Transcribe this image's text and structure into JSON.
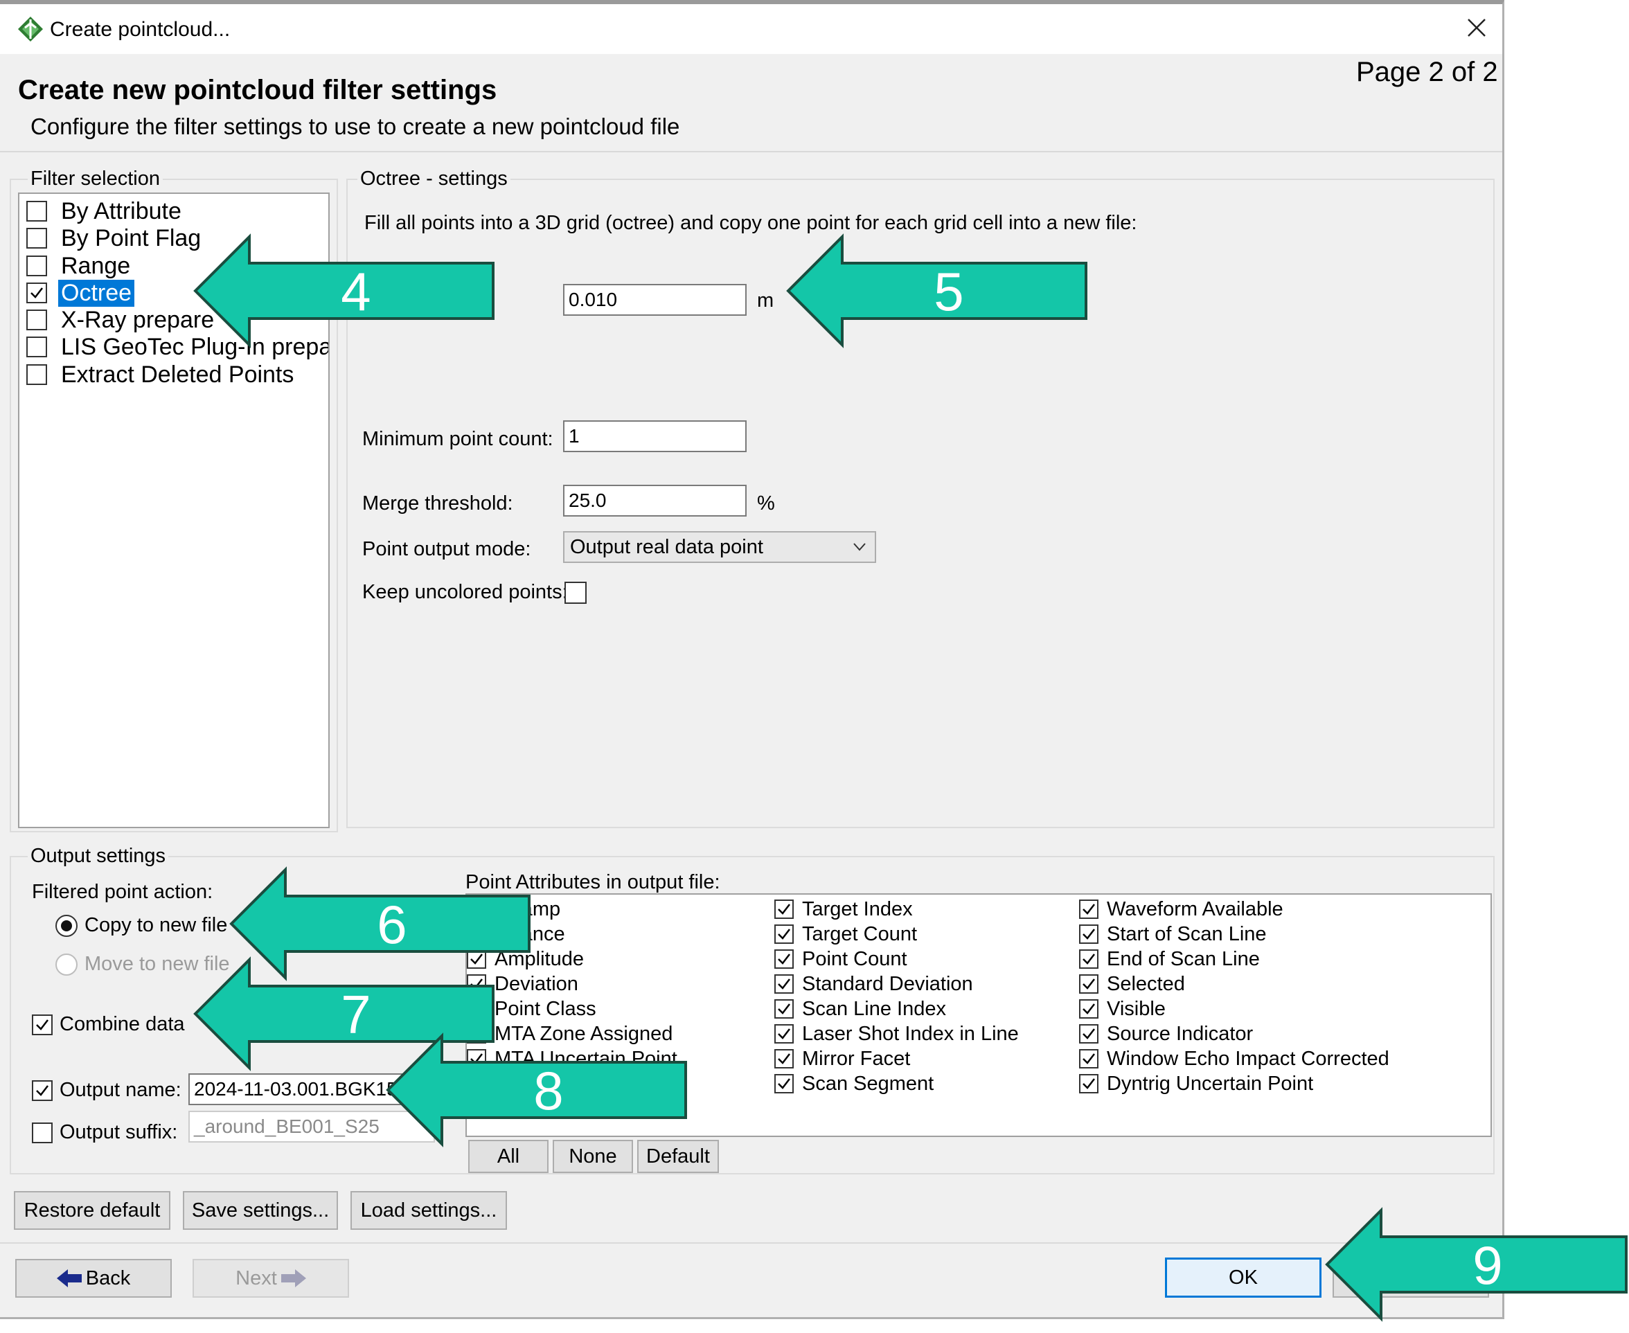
{
  "window": {
    "title": "Create pointcloud...",
    "page_indicator": "Page 2 of 2"
  },
  "header": {
    "title": "Create new pointcloud filter settings",
    "subtitle": "Configure the filter settings to use to create a new pointcloud file"
  },
  "filter_selection": {
    "label": "Filter selection",
    "items": [
      {
        "label": "By Attribute",
        "checked": false
      },
      {
        "label": "By Point Flag",
        "checked": false
      },
      {
        "label": "Range",
        "checked": false
      },
      {
        "label": "Octree",
        "checked": true
      },
      {
        "label": "X-Ray prepare",
        "checked": false
      },
      {
        "label": "LIS GeoTec Plug-In prepare",
        "checked": false
      },
      {
        "label": "Extract Deleted Points",
        "checked": false
      }
    ]
  },
  "octree": {
    "label": "Octree - settings",
    "description": "Fill all points into a 3D grid (octree) and copy one point for each grid cell into a new file:",
    "cell_size": "0.010",
    "cell_unit": "m",
    "min_count_label": "Minimum point count:",
    "min_count": "1",
    "merge_label": "Merge threshold:",
    "merge_value": "25.0",
    "merge_unit": "%",
    "output_mode_label": "Point output mode:",
    "output_mode": "Output real data point",
    "keep_uncolored_label": "Keep uncolored points:"
  },
  "output": {
    "label": "Output settings",
    "action_label": "Filtered point action:",
    "copy_label": "Copy to new file",
    "move_label": "Move to new file",
    "combine_label": "Combine data",
    "name_label": "Output name:",
    "name_value": "2024-11-03.001.BGK15",
    "suffix_label": "Output suffix:",
    "suffix_value": "_around_BE001_S25"
  },
  "attributes": {
    "label": "Point Attributes in output file:",
    "col1": [
      "estamp",
      "ectance",
      "Amplitude",
      "Deviation",
      "Point Class",
      "MTA Zone Assigned",
      "MTA Uncertain Point",
      ""
    ],
    "col2": [
      "Target Index",
      "Target Count",
      "Point Count",
      "Standard Deviation",
      "Scan Line Index",
      "Laser Shot Index in Line",
      "Mirror Facet",
      "Scan Segment"
    ],
    "col3": [
      "Waveform Available",
      "Start of Scan Line",
      "End of Scan Line",
      "Selected",
      "Visible",
      "Source Indicator",
      "Window Echo Impact Corrected",
      "Dyntrig Uncertain Point"
    ],
    "btn_all": "All",
    "btn_none": "None",
    "btn_default": "Default"
  },
  "footer": {
    "restore": "Restore default",
    "save": "Save settings...",
    "load": "Load settings...",
    "back": "Back",
    "next": "Next",
    "ok": "OK"
  },
  "callouts": [
    "4",
    "5",
    "6",
    "7",
    "8",
    "9"
  ],
  "colors": {
    "arrow": "#14c6a8",
    "selection": "#0078d7"
  }
}
